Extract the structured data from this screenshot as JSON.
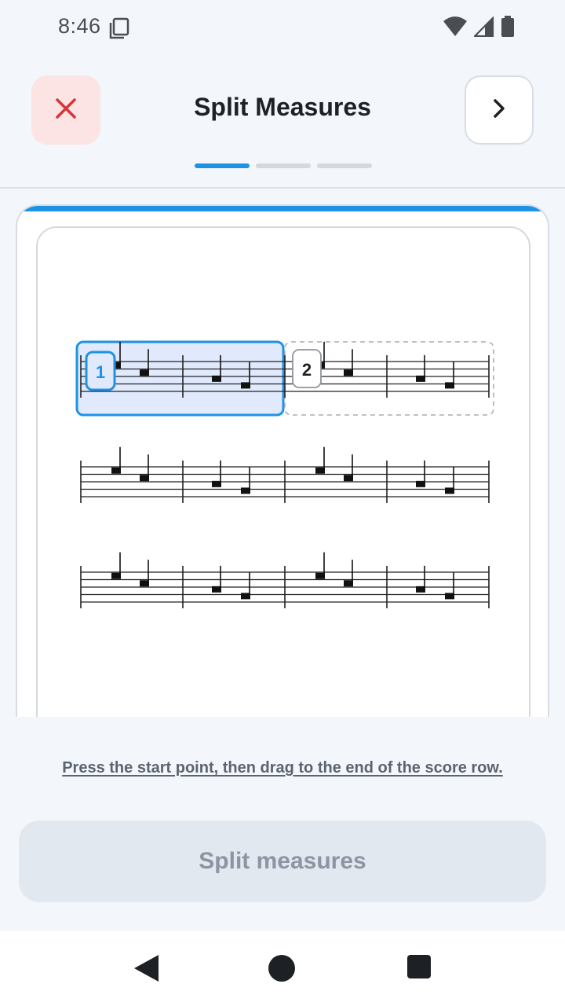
{
  "status": {
    "time": "8:46",
    "icons": [
      "sim-card-icon",
      "wifi-icon",
      "cellular-signal-icon",
      "battery-icon"
    ]
  },
  "header": {
    "title": "Split Measures",
    "close_icon": "close-icon",
    "next_icon": "chevron-right-icon",
    "steps_total": 3,
    "steps_active": 1
  },
  "score": {
    "selection_markers": [
      "1",
      "2"
    ]
  },
  "hint": "Press the start point, then drag to the end of the score row.",
  "action": {
    "label": "Split measures",
    "enabled": false
  },
  "navigation": {
    "back_icon": "back-triangle-icon",
    "home_icon": "home-circle-icon",
    "recents_icon": "recents-square-icon"
  },
  "colors": {
    "accent": "#1e93e6",
    "close_bg": "#fde4e4",
    "close_icon": "#d6343a",
    "disabled_button": "#e1e8f0",
    "selection_fill": "#e0eafc"
  }
}
